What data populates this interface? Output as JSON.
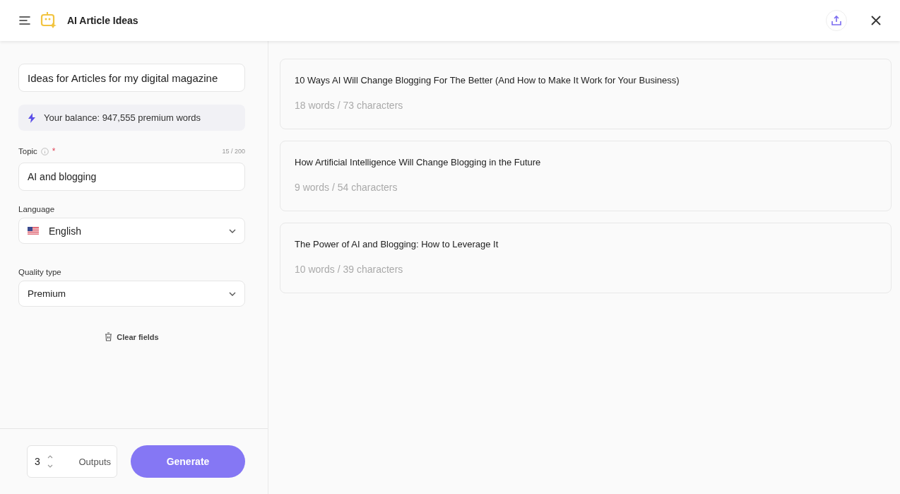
{
  "header": {
    "title": "AI Article Ideas"
  },
  "form": {
    "name_value": "Ideas for Articles for my digital magazine",
    "balance": "Your balance: 947,555 premium words",
    "topic": {
      "label": "Topic",
      "required_mark": "*",
      "counter": "15 / 200",
      "value": "AI and blogging"
    },
    "language": {
      "label": "Language",
      "value": "English"
    },
    "quality": {
      "label": "Quality type",
      "value": "Premium"
    },
    "clear": "Clear fields"
  },
  "footer": {
    "outputs_count": "3",
    "outputs_label": "Outputs",
    "generate": "Generate"
  },
  "results": [
    {
      "title": "10 Ways AI Will Change Blogging For The Better (And How to Make It Work for Your Business)",
      "stats": "18 words / 73 characters"
    },
    {
      "title": "How Artificial Intelligence Will Change Blogging in the Future",
      "stats": "9 words / 54 characters"
    },
    {
      "title": "The Power of AI and Blogging: How to Leverage It",
      "stats": "10 words / 39 characters"
    }
  ]
}
